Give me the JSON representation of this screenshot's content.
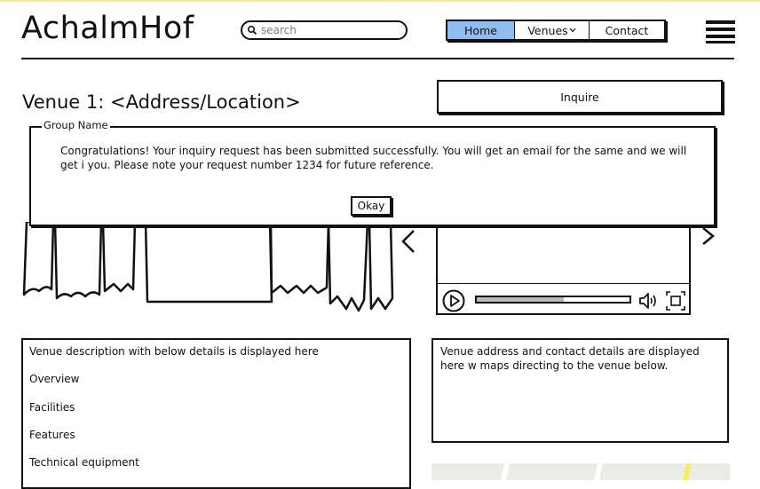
{
  "header": {
    "logo": "AchalmHof",
    "search": {
      "placeholder": "search"
    },
    "nav": [
      {
        "label": "Home",
        "active": true
      },
      {
        "label": "Venues",
        "has_dropdown": true
      },
      {
        "label": "Contact"
      }
    ]
  },
  "page": {
    "title": "Venue 1: <Address/Location>",
    "inquire_button": "Inquire"
  },
  "dialog": {
    "group_label": "Group Name",
    "message": "Congratulations! Your inquiry request has been submitted successfully. You will get an email for the same and we will get i you. Please note your request number 1234 for future reference.",
    "button": "Okay"
  },
  "video_player": {
    "progress": 0.57
  },
  "description": {
    "heading": "Venue description with below details is displayed here",
    "items": [
      "Overview",
      "Facilities",
      "Features",
      "Technical equipment"
    ]
  },
  "address_box": {
    "text": "Venue address and contact details are displayed here w maps directing to the venue below."
  },
  "colors": {
    "active_nav": "#90bdef",
    "top_line": "#f3ef88",
    "map_bg": "#ecebe5"
  },
  "icons": [
    "search-icon",
    "chevron-down-icon",
    "hamburger-icon",
    "chevron-left-icon",
    "chevron-right-icon",
    "play-icon",
    "volume-icon",
    "fullscreen-icon"
  ]
}
